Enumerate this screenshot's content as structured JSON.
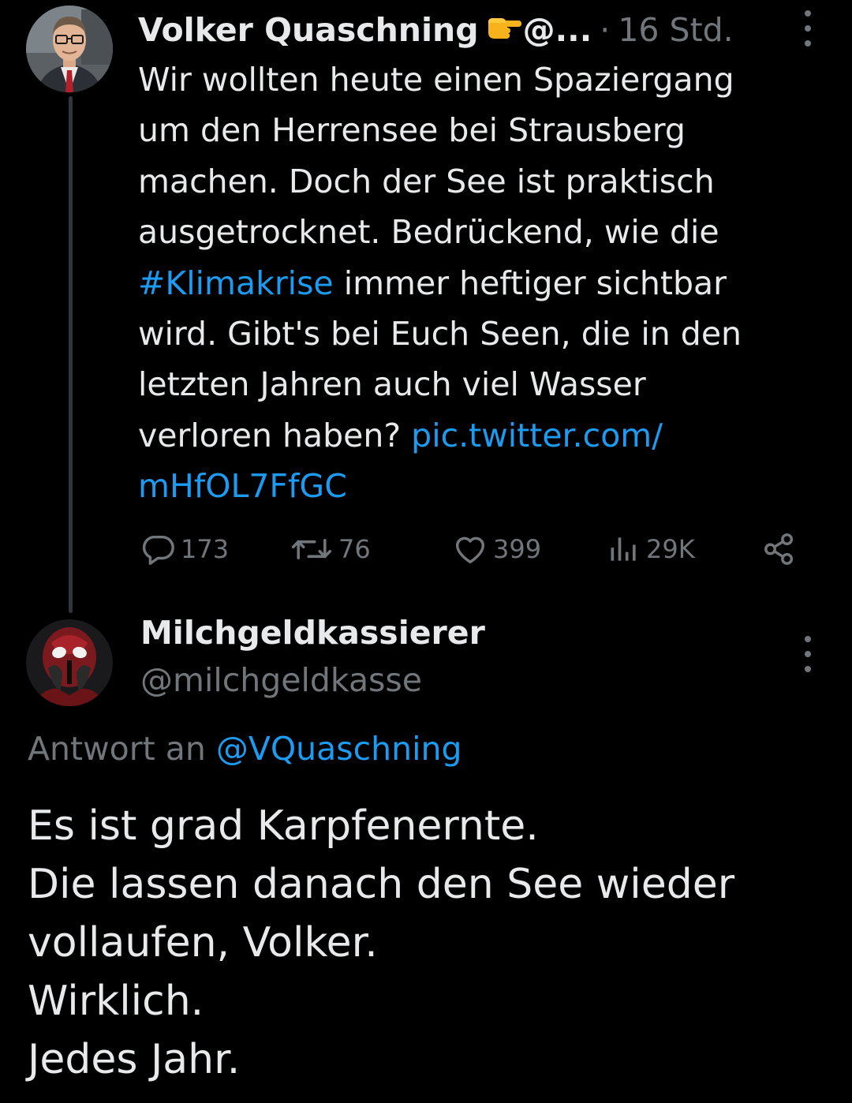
{
  "tweet": {
    "author_name": "Volker Quaschning",
    "author_emoji": "👉",
    "author_handle_truncated": "@...",
    "separator": "·",
    "time": "16 Std.",
    "text_before_hashtag": "Wir wollten heute einen Spaziergang\num den Herrensee bei Strausberg\nmachen. Doch der See ist praktisch\nausgetrocknet. Bedrückend, wie die\n",
    "hashtag": "#Klimakrise",
    "text_after_hashtag": " immer heftiger sichtbar\nwird. Gibt's bei Euch Seen, die in den\nletzten Jahren auch viel Wasser\nverloren haben? ",
    "link_line1": "pic.twitter.com/",
    "link_line2": "mHfOL7FfGC",
    "actions": {
      "replies": "173",
      "retweets": "76",
      "likes": "399",
      "views": "29K"
    },
    "icons": {
      "reply": "reply-icon",
      "retweet": "retweet-icon",
      "like": "heart-icon",
      "views": "views-icon",
      "share": "share-icon",
      "more": "more-options-icon"
    }
  },
  "reply": {
    "author_name": "Milchgeldkassierer",
    "author_handle": "@milchgeldkasse",
    "reply_to_prefix": "Antwort an ",
    "reply_to_handle": "@VQuaschning",
    "lines": [
      "Es ist grad Karpfenernte.",
      "Die lassen danach den See wieder",
      "vollaufen, Volker.",
      "Wirklich.",
      "Jedes Jahr."
    ]
  },
  "colors": {
    "background": "#000000",
    "text": "#e7e9ea",
    "secondary": "#71767b",
    "link": "#1d9bf0",
    "thread_line": "#333639"
  }
}
